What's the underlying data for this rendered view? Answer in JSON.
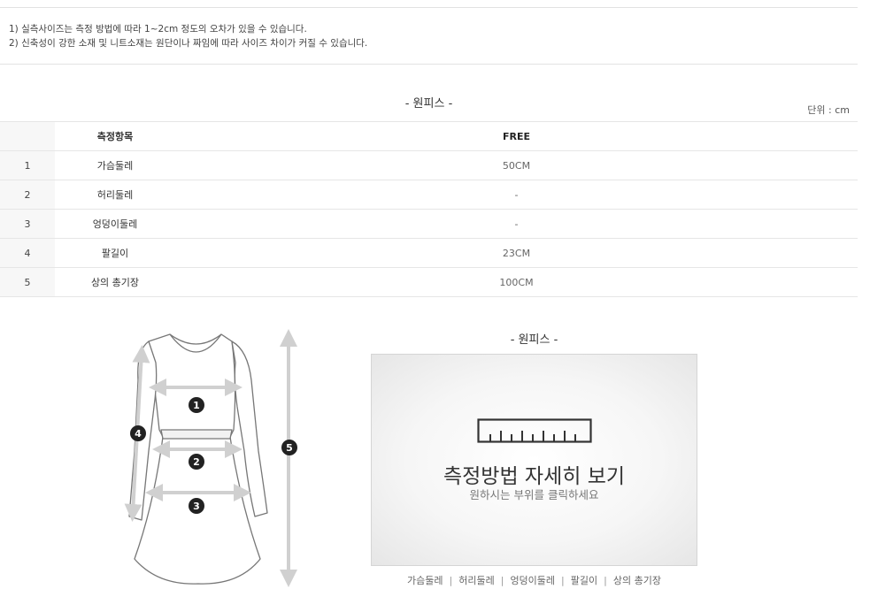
{
  "notes": [
    "1) 실측사이즈는 측정 방법에 따라 1~2cm 정도의 오차가 있을 수 있습니다.",
    "2) 신축성이 강한 소재 및 니트소재는 원단이나 짜임에 따라 사이즈 차이가 커질 수 있습니다."
  ],
  "section_title": "- 원피스 -",
  "unit_label": "단위 : cm",
  "table": {
    "headers": [
      "",
      "측정항목",
      "FREE"
    ],
    "rows": [
      {
        "num": "1",
        "item": "가슴둘레",
        "value": "50CM"
      },
      {
        "num": "2",
        "item": "허리둘레",
        "value": "-"
      },
      {
        "num": "3",
        "item": "엉덩이둘레",
        "value": "-"
      },
      {
        "num": "4",
        "item": "팔길이",
        "value": "23CM"
      },
      {
        "num": "5",
        "item": "상의 총기장",
        "value": "100CM"
      }
    ]
  },
  "diagram": {
    "markers": [
      "1",
      "2",
      "3",
      "4",
      "5"
    ]
  },
  "measure_panel": {
    "title": "- 원피스 -",
    "box_title": "측정방법 자세히 보기",
    "box_subtitle": "원하시는 부위를 클릭하세요",
    "parts": [
      "가슴둘레",
      "허리둘레",
      "엉덩이둘레",
      "팔길이",
      "상의 총기장"
    ]
  },
  "colors": {
    "rule": "#e2e2e2",
    "num_column_bg": "#f7f7f7",
    "marker": "#222222",
    "arrow": "#d0d0d0"
  }
}
